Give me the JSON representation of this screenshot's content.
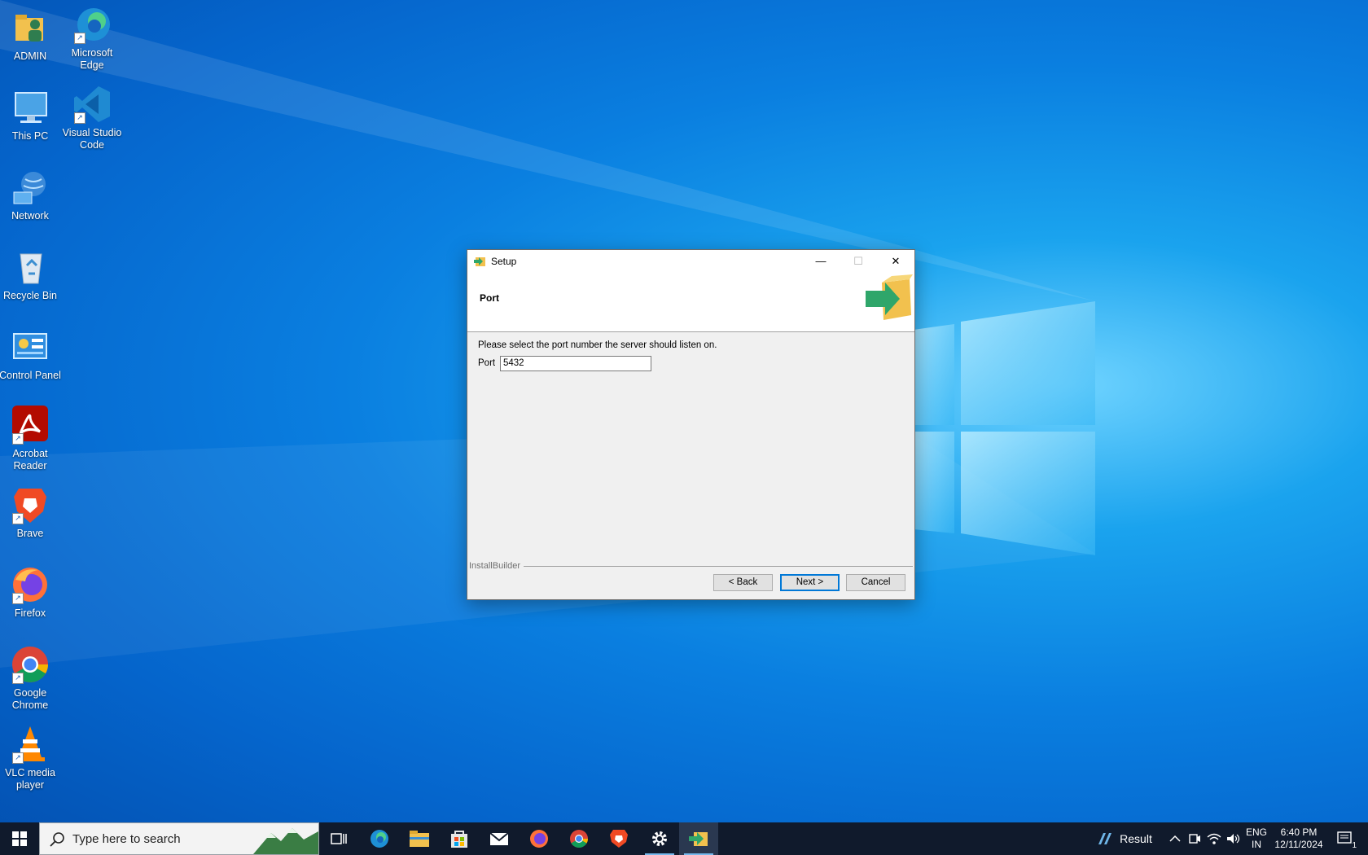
{
  "desktop": {
    "icons": [
      {
        "label": "ADMIN"
      },
      {
        "label": "Microsoft Edge"
      },
      {
        "label": "This PC"
      },
      {
        "label": "Visual Studio Code"
      },
      {
        "label": "Network"
      },
      {
        "label": "Recycle Bin"
      },
      {
        "label": "Control Panel"
      },
      {
        "label": "Acrobat Reader"
      },
      {
        "label": "Brave"
      },
      {
        "label": "Firefox"
      },
      {
        "label": "Google Chrome"
      },
      {
        "label": "VLC media player"
      }
    ]
  },
  "dialog": {
    "title": "Setup",
    "header_title": "Port",
    "description": "Please select the port number the server should listen on.",
    "port_label": "Port",
    "port_value": "5432",
    "brand": "InstallBuilder",
    "back_label": "< Back",
    "next_label": "Next >",
    "cancel_label": "Cancel",
    "minimize_glyph": "—",
    "maximize_glyph": "☐",
    "close_glyph": "✕"
  },
  "taskbar": {
    "search_placeholder": "Type here to search",
    "weather_label": "Result",
    "lang_line1": "ENG",
    "lang_line2": "IN",
    "time": "6:40 PM",
    "date": "12/11/2024",
    "notification_count": "1"
  },
  "colors": {
    "accent": "#0078d7",
    "taskbar": "#101a2c",
    "dialog_bg": "#f0f0f0"
  }
}
